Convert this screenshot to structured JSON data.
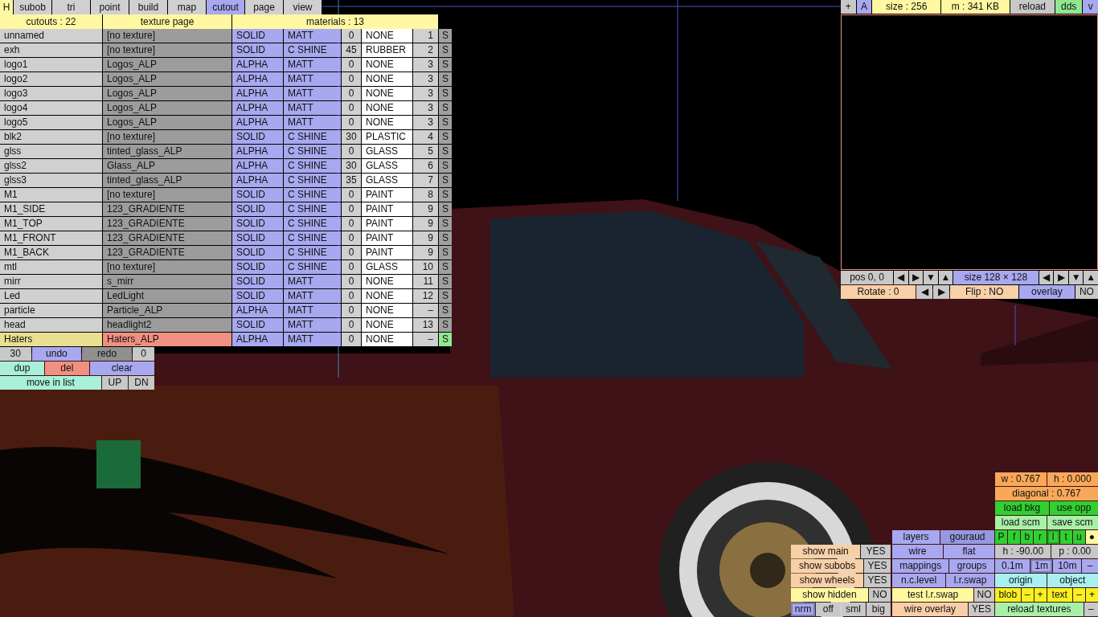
{
  "tabs": [
    {
      "label": "H",
      "kind": "hotkey",
      "selected": false
    },
    {
      "label": "subob",
      "kind": "tab",
      "selected": false
    },
    {
      "label": "tri",
      "kind": "tab",
      "selected": false
    },
    {
      "label": "point",
      "kind": "tab",
      "selected": false
    },
    {
      "label": "build",
      "kind": "tab",
      "selected": false
    },
    {
      "label": "map",
      "kind": "tab",
      "selected": false
    },
    {
      "label": "cutout",
      "kind": "tab",
      "selected": true
    },
    {
      "label": "page",
      "kind": "tab",
      "selected": false
    },
    {
      "label": "view",
      "kind": "tab",
      "selected": false
    }
  ],
  "cutout_table": {
    "headers": [
      "cutouts : 22",
      "texture page",
      "materials : 13"
    ],
    "rows": [
      {
        "name": "unnamed",
        "texture": "[no texture]",
        "type": "SOLID",
        "shine": "MATT",
        "value": "0",
        "material": "NONE",
        "index": "1",
        "s": "S",
        "selected": false
      },
      {
        "name": "exh",
        "texture": "[no texture]",
        "type": "SOLID",
        "shine": "C SHINE",
        "value": "45",
        "material": "RUBBER",
        "index": "2",
        "s": "S",
        "selected": false
      },
      {
        "name": "logo1",
        "texture": "Logos_ALP",
        "type": "ALPHA",
        "shine": "MATT",
        "value": "0",
        "material": "NONE",
        "index": "3",
        "s": "S",
        "selected": false
      },
      {
        "name": "logo2",
        "texture": "Logos_ALP",
        "type": "ALPHA",
        "shine": "MATT",
        "value": "0",
        "material": "NONE",
        "index": "3",
        "s": "S",
        "selected": false
      },
      {
        "name": "logo3",
        "texture": "Logos_ALP",
        "type": "ALPHA",
        "shine": "MATT",
        "value": "0",
        "material": "NONE",
        "index": "3",
        "s": "S",
        "selected": false
      },
      {
        "name": "logo4",
        "texture": "Logos_ALP",
        "type": "ALPHA",
        "shine": "MATT",
        "value": "0",
        "material": "NONE",
        "index": "3",
        "s": "S",
        "selected": false
      },
      {
        "name": "logo5",
        "texture": "Logos_ALP",
        "type": "ALPHA",
        "shine": "MATT",
        "value": "0",
        "material": "NONE",
        "index": "3",
        "s": "S",
        "selected": false
      },
      {
        "name": "blk2",
        "texture": "[no texture]",
        "type": "SOLID",
        "shine": "C SHINE",
        "value": "30",
        "material": "PLASTIC",
        "index": "4",
        "s": "S",
        "selected": false
      },
      {
        "name": "glss",
        "texture": "tinted_glass_ALP",
        "type": "ALPHA",
        "shine": "C SHINE",
        "value": "0",
        "material": "GLASS",
        "index": "5",
        "s": "S",
        "selected": false
      },
      {
        "name": "glss2",
        "texture": "Glass_ALP",
        "type": "ALPHA",
        "shine": "C SHINE",
        "value": "30",
        "material": "GLASS",
        "index": "6",
        "s": "S",
        "selected": false
      },
      {
        "name": "glss3",
        "texture": "tinted_glass_ALP",
        "type": "ALPHA",
        "shine": "C SHINE",
        "value": "35",
        "material": "GLASS",
        "index": "7",
        "s": "S",
        "selected": false
      },
      {
        "name": "M1",
        "texture": "[no texture]",
        "type": "SOLID",
        "shine": "C SHINE",
        "value": "0",
        "material": "PAINT",
        "index": "8",
        "s": "S",
        "selected": false
      },
      {
        "name": "M1_SIDE",
        "texture": "123_GRADIENTE",
        "type": "SOLID",
        "shine": "C SHINE",
        "value": "0",
        "material": "PAINT",
        "index": "9",
        "s": "S",
        "selected": false
      },
      {
        "name": "M1_TOP",
        "texture": "123_GRADIENTE",
        "type": "SOLID",
        "shine": "C SHINE",
        "value": "0",
        "material": "PAINT",
        "index": "9",
        "s": "S",
        "selected": false
      },
      {
        "name": "M1_FRONT",
        "texture": "123_GRADIENTE",
        "type": "SOLID",
        "shine": "C SHINE",
        "value": "0",
        "material": "PAINT",
        "index": "9",
        "s": "S",
        "selected": false
      },
      {
        "name": "M1_BACK",
        "texture": "123_GRADIENTE",
        "type": "SOLID",
        "shine": "C SHINE",
        "value": "0",
        "material": "PAINT",
        "index": "9",
        "s": "S",
        "selected": false
      },
      {
        "name": "mtl",
        "texture": "[no texture]",
        "type": "SOLID",
        "shine": "C SHINE",
        "value": "0",
        "material": "GLASS",
        "index": "10",
        "s": "S",
        "selected": false
      },
      {
        "name": "mirr",
        "texture": "s_mirr",
        "type": "SOLID",
        "shine": "MATT",
        "value": "0",
        "material": "NONE",
        "index": "11",
        "s": "S",
        "selected": false
      },
      {
        "name": "Led",
        "texture": "LedLight",
        "type": "SOLID",
        "shine": "MATT",
        "value": "0",
        "material": "NONE",
        "index": "12",
        "s": "S",
        "selected": false
      },
      {
        "name": "particle",
        "texture": "Particle_ALP",
        "type": "ALPHA",
        "shine": "MATT",
        "value": "0",
        "material": "NONE",
        "index": "–",
        "s": "S",
        "selected": false
      },
      {
        "name": "head",
        "texture": "headlight2",
        "type": "SOLID",
        "shine": "MATT",
        "value": "0",
        "material": "NONE",
        "index": "13",
        "s": "S",
        "selected": false
      },
      {
        "name": "Haters",
        "texture": "Haters_ALP",
        "type": "ALPHA",
        "shine": "MATT",
        "value": "0",
        "material": "NONE",
        "index": "–",
        "s": "S",
        "selected": true
      }
    ]
  },
  "cutout_tools": [
    [
      {
        "label": "30",
        "color": "#c8c8c8"
      },
      {
        "label": "undo",
        "color": "#a8a8f0"
      },
      {
        "label": "redo",
        "color": "#909090"
      },
      {
        "label": "0",
        "color": "#c8c8c8"
      }
    ],
    [
      {
        "label": "dup",
        "color": "#a8f0d8"
      },
      {
        "label": "del",
        "color": "#f09080"
      },
      {
        "label": "clear",
        "color": "#a8a8f0"
      }
    ],
    [
      {
        "label": "move in list",
        "color": "#a8f0d8"
      },
      {
        "label": "UP",
        "color": "#c8c8c8"
      },
      {
        "label": "DN",
        "color": "#c8c8c8"
      }
    ]
  ],
  "texture_panel": {
    "toolbar": [
      {
        "label": "+",
        "color": "#c8c8c8"
      },
      {
        "label": "A",
        "color": "#a8a8f0"
      },
      {
        "label": "size : 256",
        "color": "#fff8a0"
      },
      {
        "label": "m : 341 KB",
        "color": "#fff8a0"
      },
      {
        "label": "reload",
        "color": "#c8c8c8"
      },
      {
        "label": "dds",
        "color": "#90e890"
      },
      {
        "label": "v",
        "color": "#a8a8f0"
      }
    ],
    "position_controls": [
      {
        "label": "pos 0, 0",
        "color": "#c8c8c8"
      },
      {
        "label": "◀",
        "color": "#c8c8c8"
      },
      {
        "label": "▶",
        "color": "#c8c8c8"
      },
      {
        "label": "▼",
        "color": "#c8c8c8"
      },
      {
        "label": "▲",
        "color": "#c8c8c8"
      },
      {
        "label": "size 128 × 128",
        "color": "#a8a8f0"
      },
      {
        "label": "◀",
        "color": "#c8c8c8"
      },
      {
        "label": "▶",
        "color": "#c8c8c8"
      },
      {
        "label": "▼",
        "color": "#c8c8c8"
      },
      {
        "label": "▲",
        "color": "#c8c8c8"
      }
    ],
    "transform_controls": [
      {
        "label": "Rotate : 0",
        "color": "#f8d0a8"
      },
      {
        "label": "◀",
        "color": "#c8c8c8"
      },
      {
        "label": "▶",
        "color": "#c8c8c8"
      },
      {
        "label": "Flip : NO",
        "color": "#f8d0a8"
      },
      {
        "label": "overlay",
        "color": "#a8a8f0"
      },
      {
        "label": "NO",
        "color": "#c8c8c8"
      }
    ]
  },
  "show_panel": [
    [
      {
        "label": "show main",
        "color": "#f8d0a8"
      },
      {
        "label": "YES",
        "color": "#c8c8c8"
      }
    ],
    [
      {
        "label": "show subobs",
        "color": "#f8d0a8"
      },
      {
        "label": "YES",
        "color": "#c8c8c8"
      }
    ],
    [
      {
        "label": "show wheels",
        "color": "#f8d0a8"
      },
      {
        "label": "YES",
        "color": "#c8c8c8"
      }
    ],
    [
      {
        "label": "show hidden",
        "color": "#fff8a0"
      },
      {
        "label": "NO",
        "color": "#c8c8c8"
      }
    ],
    [
      {
        "label": "nrm",
        "color": "#a8a8f0",
        "selected": true
      },
      {
        "label": "off",
        "color": "#c8c8c8",
        "selected": false
      },
      {
        "label": "sml",
        "color": "#c8c8c8",
        "selected": false
      },
      {
        "label": "big",
        "color": "#c8c8c8",
        "selected": false
      }
    ]
  ],
  "display_panel": [
    [
      {
        "label": "layers",
        "color": "#a8a8f0"
      },
      {
        "label": "gouraud",
        "color": "#9898e0"
      }
    ],
    [
      {
        "label": "wire",
        "color": "#a8a8f0"
      },
      {
        "label": "flat",
        "color": "#a8a8f0"
      }
    ],
    [
      {
        "label": "mappings",
        "color": "#a8a8f0"
      },
      {
        "label": "groups",
        "color": "#a8a8f0"
      }
    ],
    [
      {
        "label": "n.c.level",
        "color": "#a8a8f0"
      },
      {
        "label": "l.r.swap",
        "color": "#a8a8f0"
      }
    ],
    [
      {
        "label": "test l.r.swap",
        "color": "#fff8a0"
      },
      {
        "label": "NO",
        "color": "#c8c8c8"
      }
    ],
    [
      {
        "label": "wire overlay",
        "color": "#f8d0a8"
      },
      {
        "label": "YES",
        "color": "#c8c8c8"
      }
    ]
  ],
  "view_panel": [
    [
      {
        "label": "w : 0.767",
        "color": "#f8a858"
      },
      {
        "label": "h : 0.000",
        "color": "#f8a858"
      }
    ],
    [
      {
        "label": "diagonal : 0.767",
        "color": "#f8a858"
      }
    ],
    [
      {
        "label": "load bkg",
        "color": "#30d030"
      },
      {
        "label": "use opp",
        "color": "#30d030"
      }
    ],
    [
      {
        "label": "load scm",
        "color": "#a8f0a8"
      },
      {
        "label": "save scm",
        "color": "#a8f0a8"
      }
    ],
    [
      {
        "label": "P",
        "color": "#30d030",
        "selected": false
      },
      {
        "label": "f",
        "color": "#30d030",
        "selected": false
      },
      {
        "label": "b",
        "color": "#30d030",
        "selected": false
      },
      {
        "label": "r",
        "color": "#30d030",
        "selected": false
      },
      {
        "label": "l",
        "color": "#30d030",
        "selected": true
      },
      {
        "label": "t",
        "color": "#30d030",
        "selected": false
      },
      {
        "label": "u",
        "color": "#30d030",
        "selected": false
      },
      {
        "label": "●",
        "color": "#fff8a0",
        "selected": false
      }
    ],
    [
      {
        "label": "h : -90.00",
        "color": "#c8c8c8"
      },
      {
        "label": "p : 0.00",
        "color": "#c8c8c8"
      }
    ],
    [
      {
        "label": "0.1m",
        "color": "#a8a8f0",
        "selected": false
      },
      {
        "label": "1m",
        "color": "#a8a8f0",
        "selected": true
      },
      {
        "label": "10m",
        "color": "#a8a8f0",
        "selected": false
      },
      {
        "label": "–",
        "color": "#a8a8f0",
        "selected": false
      }
    ],
    [
      {
        "label": "origin",
        "color": "#a8f0f0"
      },
      {
        "label": "object",
        "color": "#a8f0f0"
      }
    ],
    [
      {
        "label": "blob",
        "color": "#f8f020"
      },
      {
        "label": "–",
        "color": "#f8f020"
      },
      {
        "label": "+",
        "color": "#f8f020"
      },
      {
        "label": "text",
        "color": "#f8f020"
      },
      {
        "label": "–",
        "color": "#f8f020"
      },
      {
        "label": "+",
        "color": "#f8f020"
      }
    ],
    [
      {
        "label": "reload textures",
        "color": "#a8f0a8"
      },
      {
        "label": "–",
        "color": "#c8c8c8"
      }
    ]
  ]
}
